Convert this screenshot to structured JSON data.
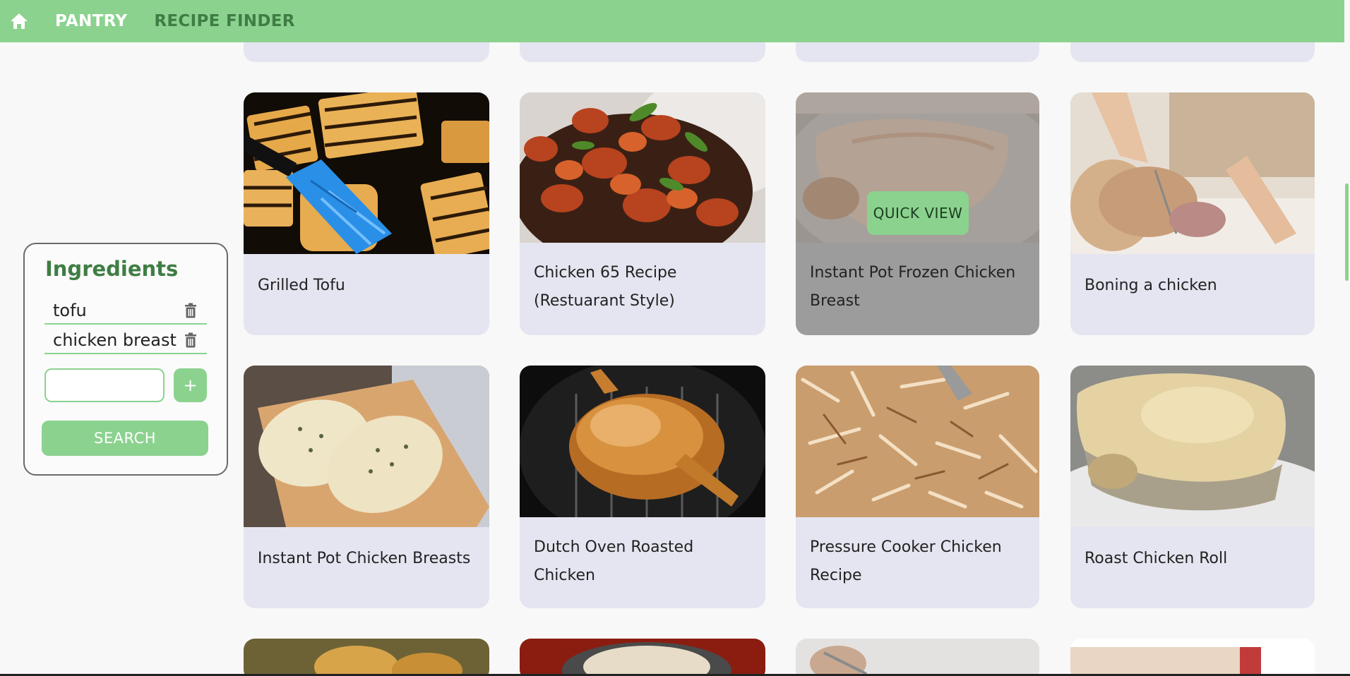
{
  "nav": {
    "home_icon": "home-icon",
    "pantry_label": "PANTRY",
    "finder_label": "RECIPE FINDER"
  },
  "sidebar": {
    "title": "Ingredients",
    "ingredients": [
      "tofu",
      "chicken breast"
    ],
    "new_ingredient_value": "",
    "add_label": "+",
    "search_label": "SEARCH"
  },
  "recipes": [
    {
      "title": "Grilled Tofu"
    },
    {
      "title": "Chicken 65 Recipe (Restuarant Style)"
    },
    {
      "title": "Instant Pot Frozen Chicken Breast",
      "quick_view": "QUICK VIEW"
    },
    {
      "title": "Boning a chicken"
    },
    {
      "title": "Instant Pot Chicken Breasts"
    },
    {
      "title": "Dutch Oven Roasted Chicken"
    },
    {
      "title": "Pressure Cooker Chicken Recipe"
    },
    {
      "title": "Roast Chicken Roll"
    }
  ],
  "colors": {
    "accent": "#8bd28f",
    "accent_dark": "#3f7d44",
    "card_bg": "#e5e5f1",
    "card_hover_bg": "#9c9c9c"
  }
}
